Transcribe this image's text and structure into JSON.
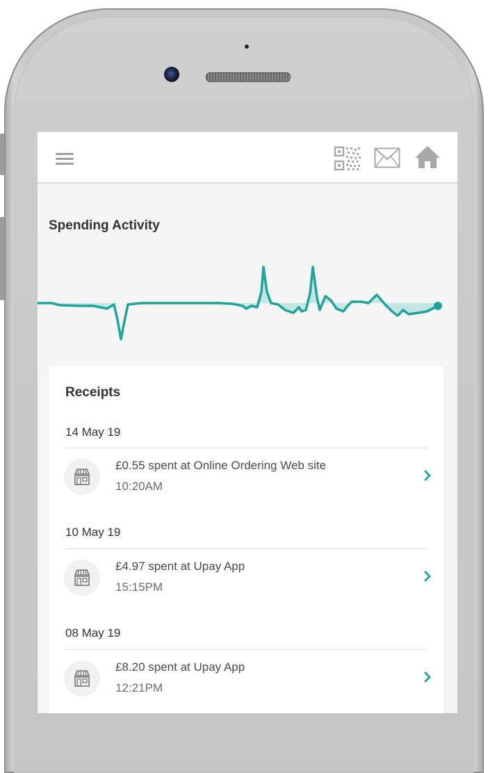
{
  "header": {
    "icons": [
      "menu-icon",
      "qr-code-icon",
      "mail-icon",
      "home-icon"
    ]
  },
  "spending": {
    "title": "Spending Activity",
    "accent_color": "#1fa39c",
    "fill_color": "#bfe4e1"
  },
  "receipts": {
    "title": "Receipts",
    "groups": [
      {
        "date": "14 May 19",
        "items": [
          {
            "description": "£0.55 spent at Online Ordering Web site",
            "time": "10:20AM",
            "icon": "store-icon"
          }
        ]
      },
      {
        "date": "10 May 19",
        "items": [
          {
            "description": "£4.97 spent at Upay App",
            "time": "15:15PM",
            "icon": "store-icon"
          }
        ]
      },
      {
        "date": "08 May 19",
        "items": [
          {
            "description": "£8.20 spent at Upay App",
            "time": "12:21PM",
            "icon": "store-icon"
          }
        ]
      }
    ]
  }
}
